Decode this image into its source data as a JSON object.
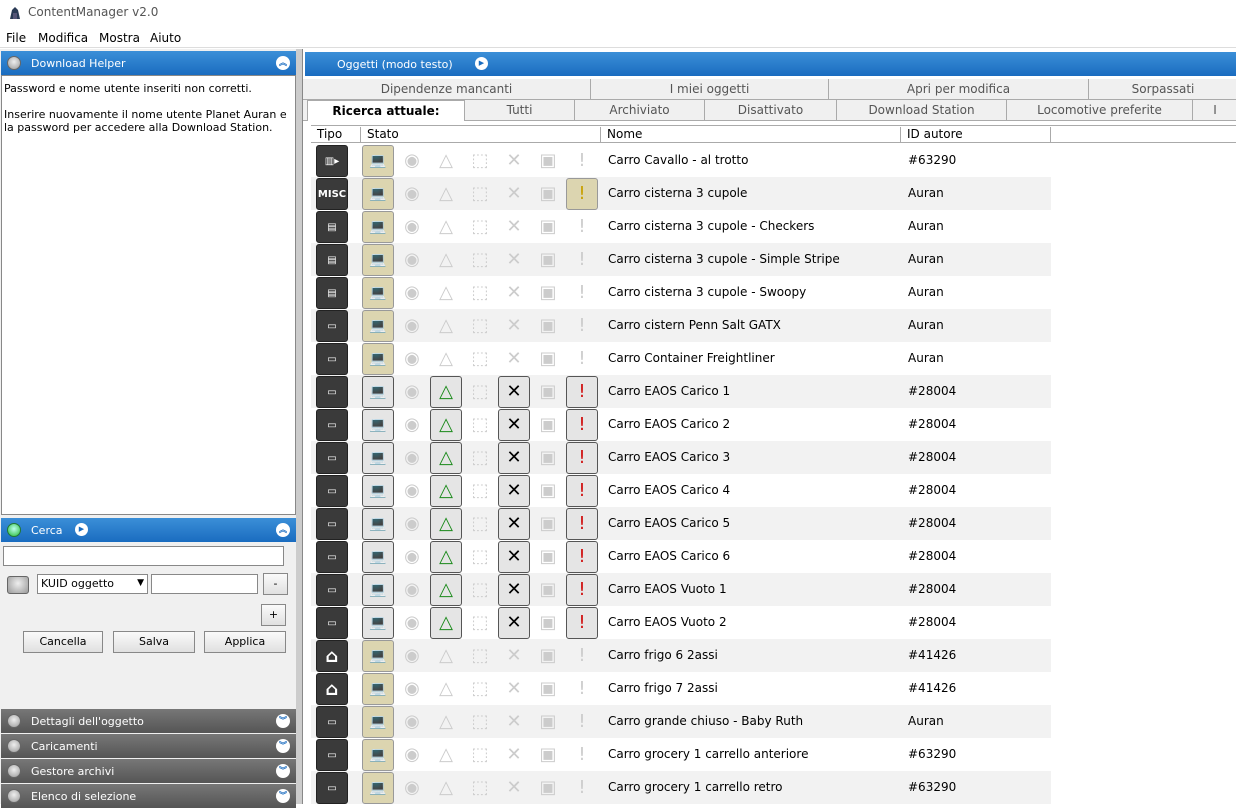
{
  "app": {
    "title": "ContentManager v2.0"
  },
  "menu": [
    "File",
    "Modifica",
    "Mostra",
    "Aiuto"
  ],
  "download_helper": {
    "title": "Download Helper",
    "line1": "Password e nome utente inseriti non corretti.",
    "line2": "Inserire nuovamente il nome utente Planet Auran e",
    "line3": "la password per accedere alla Download Station."
  },
  "search": {
    "title": "Cerca",
    "query": "",
    "kuid_select": "KUID oggetto",
    "kuid_value": "",
    "minus": "-",
    "plus": "+",
    "cancel": "Cancella",
    "save": "Salva",
    "apply": "Applica"
  },
  "panels": [
    "Dettagli dell'oggetto",
    "Caricamenti",
    "Gestore archivi",
    "Elenco di selezione"
  ],
  "objects": {
    "title": "Oggetti (modo testo)"
  },
  "tabs_row1": [
    "Dipendenze mancanti",
    "I miei oggetti",
    "Apri per modifica",
    "Sorpassati"
  ],
  "tabs_row2": [
    "Ricerca attuale:",
    "Tutti",
    "Archiviato",
    "Disattivato",
    "Download Station",
    "Locomotive preferite",
    "I"
  ],
  "columns": {
    "tipo": "Tipo",
    "stato": "Stato",
    "nome": "Nome",
    "autore": "ID autore"
  },
  "rows": [
    {
      "type": "sound",
      "name": "Carro Cavallo - al trotto",
      "author": "#63290",
      "s": [
        1,
        0,
        0,
        0,
        0,
        0,
        0
      ]
    },
    {
      "type": "MISC",
      "name": "Carro cisterna 3 cupole",
      "author": "Auran",
      "s": [
        1,
        0,
        0,
        0,
        0,
        0,
        2
      ]
    },
    {
      "type": "tank",
      "name": "Carro cisterna 3 cupole - Checkers",
      "author": "Auran",
      "s": [
        1,
        0,
        0,
        0,
        0,
        0,
        0
      ]
    },
    {
      "type": "tank",
      "name": "Carro cisterna 3 cupole - Simple Stripe",
      "author": "Auran",
      "s": [
        1,
        0,
        0,
        0,
        0,
        0,
        0
      ]
    },
    {
      "type": "tank",
      "name": "Carro cisterna 3 cupole - Swoopy",
      "author": "Auran",
      "s": [
        1,
        0,
        0,
        0,
        0,
        0,
        0
      ]
    },
    {
      "type": "wagon",
      "name": "Carro cistern Penn Salt GATX",
      "author": "Auran",
      "s": [
        1,
        0,
        0,
        0,
        0,
        0,
        0
      ]
    },
    {
      "type": "wagon",
      "name": "Carro Container Freightliner",
      "author": "Auran",
      "s": [
        1,
        0,
        0,
        0,
        0,
        0,
        0
      ]
    },
    {
      "type": "wagon",
      "name": "Carro EAOS Carico 1",
      "author": "#28004",
      "s": [
        3,
        0,
        1,
        0,
        1,
        0,
        1
      ]
    },
    {
      "type": "wagon",
      "name": "Carro EAOS Carico 2",
      "author": "#28004",
      "s": [
        3,
        0,
        1,
        0,
        1,
        0,
        1
      ]
    },
    {
      "type": "wagon",
      "name": "Carro EAOS Carico 3",
      "author": "#28004",
      "s": [
        3,
        0,
        1,
        0,
        1,
        0,
        1
      ]
    },
    {
      "type": "wagon",
      "name": "Carro EAOS Carico 4",
      "author": "#28004",
      "s": [
        3,
        0,
        1,
        0,
        1,
        0,
        1
      ]
    },
    {
      "type": "wagon",
      "name": "Carro EAOS Carico 5",
      "author": "#28004",
      "s": [
        3,
        0,
        1,
        0,
        1,
        0,
        1
      ]
    },
    {
      "type": "wagon",
      "name": "Carro EAOS Carico 6",
      "author": "#28004",
      "s": [
        3,
        0,
        1,
        0,
        1,
        0,
        1
      ]
    },
    {
      "type": "wagon",
      "name": "Carro EAOS Vuoto 1",
      "author": "#28004",
      "s": [
        3,
        0,
        1,
        0,
        1,
        0,
        1
      ]
    },
    {
      "type": "wagon",
      "name": "Carro EAOS Vuoto 2",
      "author": "#28004",
      "s": [
        3,
        0,
        1,
        0,
        1,
        0,
        1
      ]
    },
    {
      "type": "house",
      "name": "Carro frigo 6 2assi",
      "author": "#41426",
      "s": [
        1,
        0,
        0,
        0,
        0,
        0,
        0
      ]
    },
    {
      "type": "house",
      "name": "Carro frigo 7 2assi",
      "author": "#41426",
      "s": [
        1,
        0,
        0,
        0,
        0,
        0,
        0
      ]
    },
    {
      "type": "wagon",
      "name": "Carro grande chiuso - Baby Ruth",
      "author": "Auran",
      "s": [
        1,
        0,
        0,
        0,
        0,
        0,
        0
      ]
    },
    {
      "type": "wagon",
      "name": "Carro grocery 1 carrello anteriore",
      "author": "#63290",
      "s": [
        1,
        0,
        0,
        0,
        0,
        0,
        0
      ]
    },
    {
      "type": "wagon",
      "name": "Carro grocery 1 carrello retro",
      "author": "#63290",
      "s": [
        1,
        0,
        0,
        0,
        0,
        0,
        0
      ]
    }
  ]
}
